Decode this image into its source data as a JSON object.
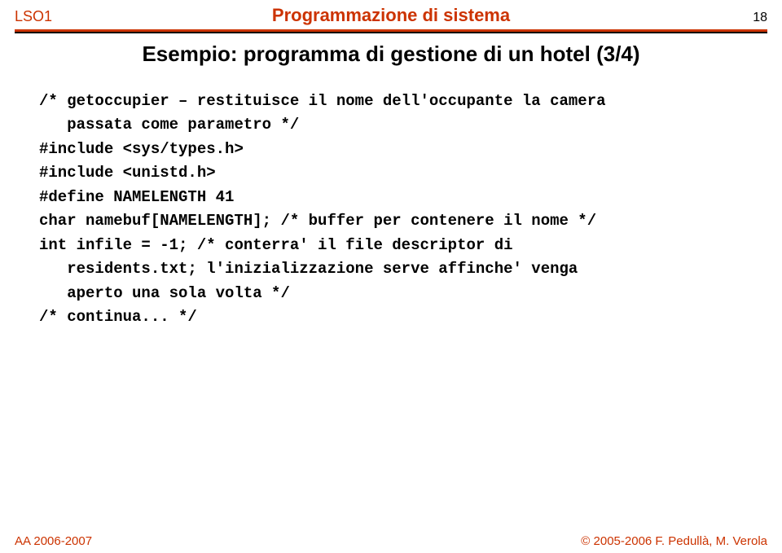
{
  "header": {
    "left": "LSO1",
    "center": "Programmazione di sistema",
    "pageNumber": "18"
  },
  "title": "Esempio: programma di gestione di un hotel (3/4)",
  "code": {
    "l1": "/* getoccupier – restituisce il nome dell'occupante la camera",
    "l2": "   passata come parametro */",
    "l3": "#include <sys/types.h>",
    "l4": "#include <unistd.h>",
    "l5": "#define NAMELENGTH 41",
    "l6": "char namebuf[NAMELENGTH]; /* buffer per contenere il nome */",
    "l7": "int infile = -1; /* conterra' il file descriptor di",
    "l8": "   residents.txt; l'inizializzazione serve affinche' venga",
    "l9": "   aperto una sola volta */",
    "l10": "/* continua... */"
  },
  "footer": {
    "left": "AA 2006-2007",
    "right": "© 2005-2006 F. Pedullà, M. Verola"
  }
}
